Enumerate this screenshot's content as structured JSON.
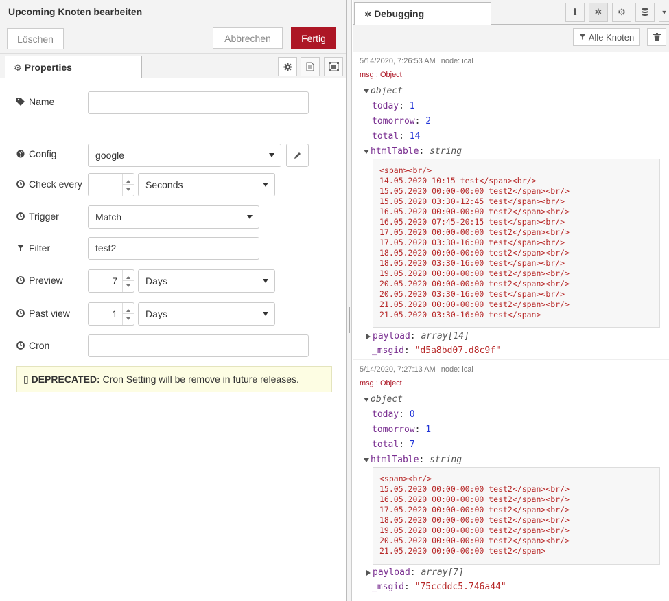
{
  "tray": {
    "title": "Upcoming Knoten bearbeiten",
    "buttons": {
      "delete": "Löschen",
      "cancel": "Abbrechen",
      "done": "Fertig"
    },
    "tab": "Properties",
    "form": {
      "name": {
        "label": "Name",
        "value": ""
      },
      "config": {
        "label": "Config",
        "value": "google"
      },
      "check_every": {
        "label": "Check every",
        "value": "",
        "unit": "Seconds"
      },
      "trigger": {
        "label": "Trigger",
        "value": "Match"
      },
      "filter": {
        "label": "Filter",
        "value": "test2"
      },
      "preview": {
        "label": "Preview",
        "value": "7",
        "unit": "Days"
      },
      "past_view": {
        "label": "Past view",
        "value": "1",
        "unit": "Days"
      },
      "cron": {
        "label": "Cron",
        "value": ""
      },
      "deprecated": {
        "title": "DEPRECATED:",
        "text": " Cron Setting will be remove in future releases.",
        "icon": "▯"
      }
    }
  },
  "sidebar": {
    "tab": "Debugging",
    "filter_button": "Alle Knoten",
    "messages": [
      {
        "time": "5/14/2020, 7:26:53 AM",
        "node": "node: ical",
        "type": "msg : Object",
        "object_label": "object",
        "today": "1",
        "tomorrow": "2",
        "total": "14",
        "htmlTable_type": "string",
        "htmlTable": "<span><br/>\n14.05.2020 10:15 test</span><br/>\n15.05.2020 00:00-00:00 test2</span><br/>\n15.05.2020 03:30-12:45 test</span><br/>\n16.05.2020 00:00-00:00 test2</span><br/>\n16.05.2020 07:45-20:15 test</span><br/>\n17.05.2020 00:00-00:00 test2</span><br/>\n17.05.2020 03:30-16:00 test</span><br/>\n18.05.2020 00:00-00:00 test2</span><br/>\n18.05.2020 03:30-16:00 test</span><br/>\n19.05.2020 00:00-00:00 test2</span><br/>\n20.05.2020 00:00-00:00 test2</span><br/>\n20.05.2020 03:30-16:00 test</span><br/>\n21.05.2020 00:00-00:00 test2</span><br/>\n21.05.2020 03:30-16:00 test</span>",
        "payload_type": "array[14]",
        "msgid": "\"d5a8bd07.d8c9f\""
      },
      {
        "time": "5/14/2020, 7:27:13 AM",
        "node": "node: ical",
        "type": "msg : Object",
        "object_label": "object",
        "today": "0",
        "tomorrow": "1",
        "total": "7",
        "htmlTable_type": "string",
        "htmlTable": "<span><br/>\n15.05.2020 00:00-00:00 test2</span><br/>\n16.05.2020 00:00-00:00 test2</span><br/>\n17.05.2020 00:00-00:00 test2</span><br/>\n18.05.2020 00:00-00:00 test2</span><br/>\n19.05.2020 00:00-00:00 test2</span><br/>\n20.05.2020 00:00-00:00 test2</span><br/>\n21.05.2020 00:00-00:00 test2</span>",
        "payload_type": "array[7]",
        "msgid": "\"75ccddc5.746a44\""
      }
    ]
  },
  "keys": {
    "today": "today",
    "tomorrow": "tomorrow",
    "total": "total",
    "htmlTable": "htmlTable",
    "payload": "payload",
    "msgid": "_msgid"
  }
}
